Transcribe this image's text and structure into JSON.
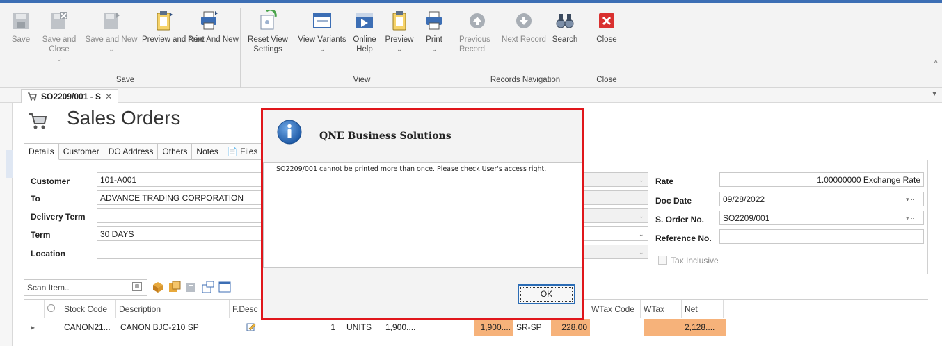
{
  "ribbon": {
    "save_group": {
      "label": "Save",
      "buttons": [
        {
          "label": "Save",
          "icon": "save-icon",
          "enabled": false
        },
        {
          "label": "Save and Close",
          "icon": "save-close-icon",
          "enabled": false
        },
        {
          "label": "Save and New",
          "icon": "save-new-icon",
          "enabled": false
        },
        {
          "label": "Preview and New",
          "icon": "preview-new-icon",
          "enabled": true
        },
        {
          "label": "Print And New",
          "icon": "print-new-icon",
          "enabled": true
        }
      ]
    },
    "view_group": {
      "label": "View",
      "buttons": [
        {
          "label": "Reset View Settings",
          "icon": "reset-view-icon"
        },
        {
          "label": "View Variants",
          "icon": "view-variants-icon"
        },
        {
          "label": "Online Help",
          "icon": "online-help-icon"
        },
        {
          "label": "Preview",
          "icon": "preview-icon"
        },
        {
          "label": "Print",
          "icon": "print-icon"
        }
      ]
    },
    "nav_group": {
      "label": "Records Navigation",
      "buttons": [
        {
          "label": "Previous Record",
          "icon": "previous-record-icon",
          "enabled": false
        },
        {
          "label": "Next Record",
          "icon": "next-record-icon",
          "enabled": false
        },
        {
          "label": "Search",
          "icon": "search-icon",
          "enabled": true
        }
      ]
    },
    "close_group": {
      "label": "Close",
      "buttons": [
        {
          "label": "Close",
          "icon": "close-icon"
        }
      ]
    }
  },
  "doc_tab": {
    "label": "SO2209/001 - S"
  },
  "form": {
    "title": "Sales Orders",
    "tabs": [
      "Details",
      "Customer",
      "DO Address",
      "Others",
      "Notes",
      "Files"
    ],
    "fields": {
      "customer": {
        "label": "Customer",
        "value": "101-A001"
      },
      "to": {
        "label": "To",
        "value": "ADVANCE TRADING CORPORATION"
      },
      "delivery_term": {
        "label": "Delivery Term",
        "value": ""
      },
      "term": {
        "label": "Term",
        "value": "30 DAYS"
      },
      "location": {
        "label": "Location",
        "value": ""
      },
      "rate": {
        "label": "Rate",
        "value": "1.00000000 Exchange Rate"
      },
      "doc_date": {
        "label": "Doc Date",
        "value": "09/28/2022"
      },
      "order_no": {
        "label": "S. Order No.",
        "value": "SO2209/001"
      },
      "reference_no": {
        "label": "Reference No.",
        "value": ""
      },
      "tax_inclusive": {
        "label": "Tax Inclusive",
        "checked": false
      }
    },
    "scan_placeholder": "Scan Item..",
    "grid": {
      "columns": [
        "Stock Code",
        "Description",
        "F.Desc",
        "WTax Code",
        "WTax",
        "Net"
      ],
      "row": {
        "stock_code": "CANON21...",
        "description": "CANON BJC-210 SP",
        "qty": "1",
        "uom": "UNITS",
        "price": "1,900....",
        "amount": "1,900....",
        "tax_code": "SR-SP",
        "tax": "228.00",
        "net": "2,128...."
      }
    }
  },
  "dialog": {
    "title": "QNE Business Solutions",
    "message": "SO2209/001 cannot be printed more than once. Please check User's access right.",
    "ok_label": "OK",
    "icon": "info-icon"
  },
  "colors": {
    "dialog_border": "#e0161b",
    "accent": "#2b6cb5",
    "highlight": "#f6b27a"
  }
}
